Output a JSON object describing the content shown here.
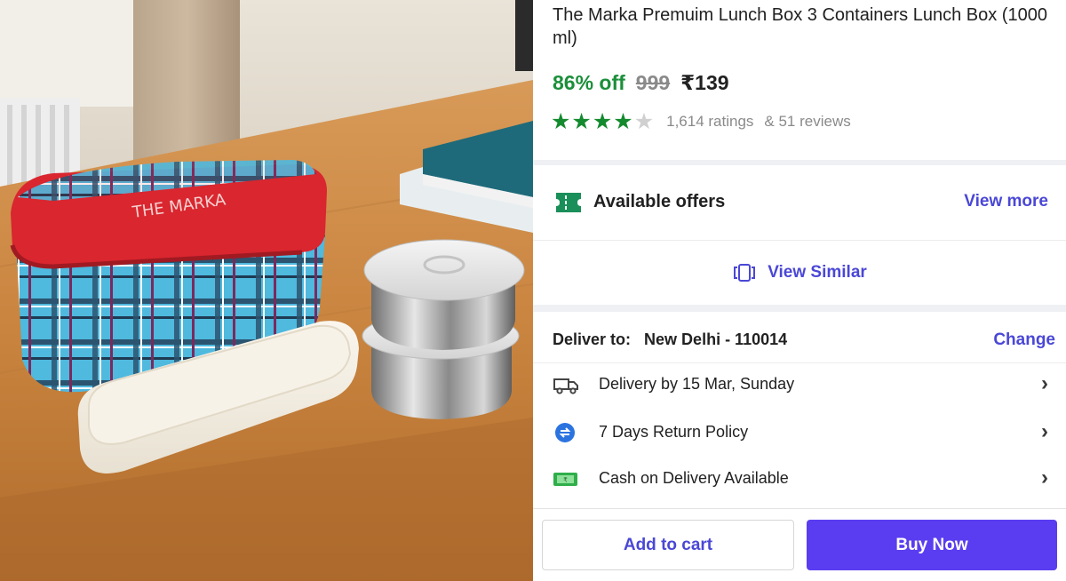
{
  "photo": {
    "brand_print": "THE MARKA"
  },
  "product": {
    "title": "The Marka Premuim Lunch Box 3 Containers Lunch Box (1000 ml)",
    "discount": "86% off",
    "mrp": "999",
    "price": "₹139",
    "rating_stars": 4,
    "rating_stars_max": 5,
    "ratings_text": "1,614 ratings",
    "reviews_text": "& 51 reviews",
    "star_color": "#138a2e"
  },
  "offers": {
    "label": "Available offers",
    "action": "View more",
    "icon": "ticket-icon"
  },
  "similar": {
    "label": "View Similar",
    "icon": "similar-cards-icon"
  },
  "delivery": {
    "label": "Deliver to:",
    "location": "New Delhi - 110014",
    "action": "Change",
    "items": [
      {
        "icon": "truck-icon",
        "text": "Delivery by 15 Mar, Sunday"
      },
      {
        "icon": "return-icon",
        "text": "7 Days Return Policy"
      },
      {
        "icon": "cash-icon",
        "text": "Cash on Delivery Available"
      }
    ]
  },
  "actions": {
    "add_to_cart": "Add to cart",
    "buy_now": "Buy Now"
  },
  "colors": {
    "accent": "#4a47d6",
    "buy_button": "#5a3df0",
    "discount": "#1b8f3a"
  }
}
